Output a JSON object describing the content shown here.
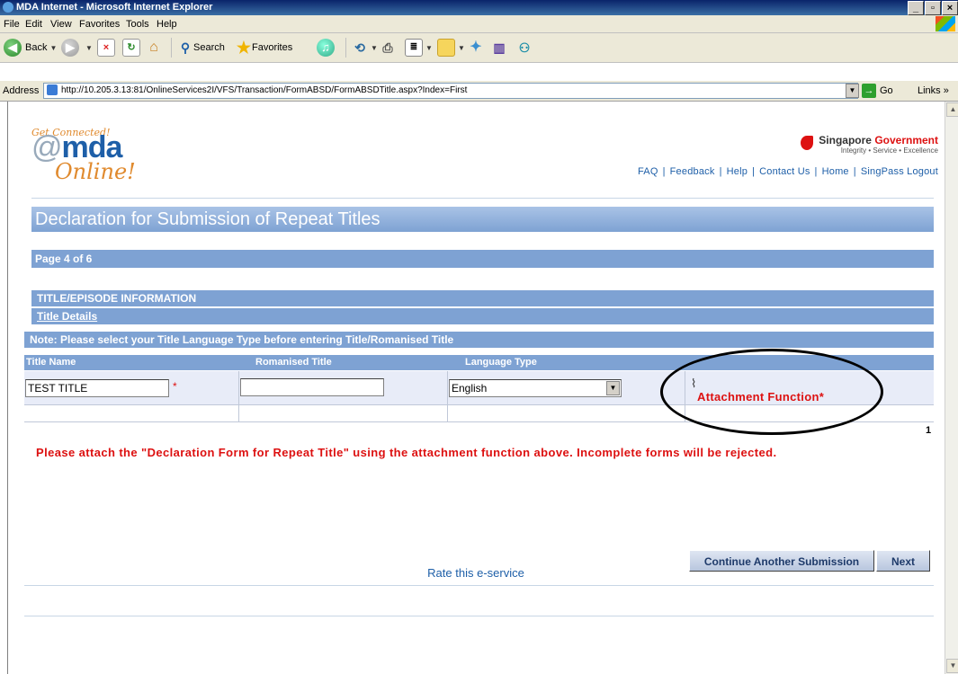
{
  "window": {
    "title": "MDA Internet - Microsoft Internet Explorer",
    "controls": [
      "_",
      "▫",
      "×"
    ]
  },
  "menu": [
    "File",
    "Edit",
    "View",
    "Favorites",
    "Tools",
    "Help"
  ],
  "toolbar": {
    "back": "Back",
    "search": "Search",
    "favorites": "Favorites"
  },
  "address": {
    "label": "Address",
    "url": "http://10.205.3.13:81/OnlineServices2I/VFS/Transaction/FormABSD/FormABSDTitle.aspx?Index=First",
    "go": "Go",
    "links": "Links"
  },
  "logo": {
    "tagline": "Get Connected!",
    "brand_at": "@",
    "brand": "mda",
    "online": "Online!"
  },
  "gov": {
    "name_prefix": "Singapore ",
    "name_suffix": "Government",
    "tagline": "Integrity • Service • Excellence"
  },
  "toplinks": [
    "FAQ",
    "Feedback",
    "Help",
    "Contact Us",
    "Home",
    "SingPass Logout"
  ],
  "page": {
    "title": "Declaration for Submission of Repeat Titles",
    "pageinfo": "Page 4 of 6",
    "section": "TITLE/EPISODE INFORMATION",
    "subsection": "Title Details",
    "note": "Note: Please select your Title Language Type before entering Title/Romanised Title"
  },
  "table": {
    "headers": [
      "Title Name",
      "Romanised Title",
      "Language Type"
    ],
    "title_name": "TEST TITLE",
    "romanised_title": "",
    "language": "English",
    "required_mark": "*",
    "attachment_label": "Attachment Function*",
    "page_number": "1"
  },
  "warning": "Please attach the \"Declaration Form for Repeat Title\" using the attachment function above. Incomplete forms will be rejected.",
  "buttons": {
    "continue": "Continue Another Submission",
    "next": "Next"
  },
  "rate": "Rate this e-service",
  "colors": {
    "accent": "#7ea2d3",
    "warning": "#dd1111",
    "link": "#1e5fa8"
  }
}
